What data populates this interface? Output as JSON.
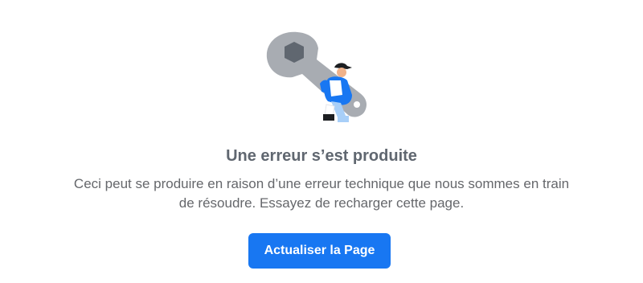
{
  "error": {
    "title": "Une erreur s’est produite",
    "message_line1": "Ceci peut se produire en raison d’une erreur technique que nous sommes en train",
    "message_line2": "de résoudre. Essayez de recharger cette page.",
    "illustration_icon": "wrench-worker-illustration"
  },
  "actions": {
    "reload_label": "Actualiser la Page"
  },
  "colors": {
    "accent": "#1877f2",
    "title": "#606770",
    "body_text": "#65676b",
    "wrench": "#a8acb2",
    "nut": "#606770"
  }
}
